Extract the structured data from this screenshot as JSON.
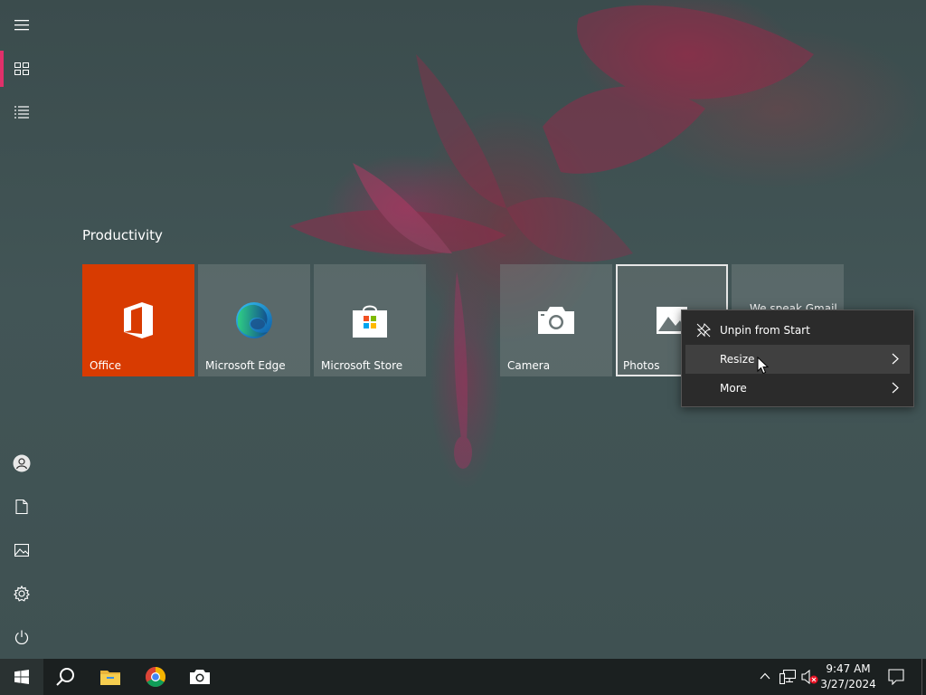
{
  "start_menu": {
    "group_title": "Productivity",
    "rail": {
      "menu_icon": "hamburger-icon",
      "tiles_icon": "tiles-icon",
      "list_icon": "all-apps-icon",
      "user_icon": "user-icon",
      "documents_icon": "document-icon",
      "pictures_icon": "pictures-icon",
      "settings_icon": "gear-icon",
      "power_icon": "power-icon"
    },
    "tiles": [
      {
        "label": "Office",
        "icon": "office-icon"
      },
      {
        "label": "Microsoft Edge",
        "icon": "edge-icon"
      },
      {
        "label": "Microsoft Store",
        "icon": "store-icon"
      },
      {
        "label": "Camera",
        "icon": "camera-icon"
      },
      {
        "label": "Photos",
        "icon": "photos-icon"
      },
      {
        "label": "We speak Gmail",
        "icon": "mail-icon"
      }
    ]
  },
  "context_menu": {
    "items": [
      {
        "label": "Unpin from Start",
        "icon": "unpin-icon"
      },
      {
        "label": "Resize",
        "icon": "chevron-right-icon"
      },
      {
        "label": "More",
        "icon": "chevron-right-icon"
      }
    ]
  },
  "taskbar": {
    "apps": [
      "windows-start-icon",
      "search-icon",
      "file-explorer-icon",
      "chrome-icon",
      "camera-icon"
    ],
    "tray": [
      "chevron-up-icon",
      "network-icon",
      "volume-muted-icon",
      "notifications-icon"
    ],
    "time": "9:47 AM",
    "date": "3/27/2024"
  },
  "colors": {
    "office_tile": "#d83b01",
    "accent": "#e0306a",
    "taskbar": "#1b2020",
    "menu_bg": "#2b2b2b"
  }
}
